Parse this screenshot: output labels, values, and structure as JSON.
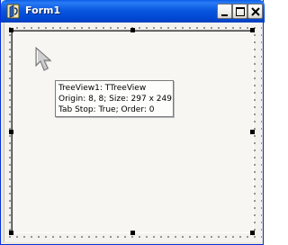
{
  "window": {
    "title": "Form1",
    "icon": "delphi-form-icon",
    "caption_buttons": [
      "minimize-icon",
      "maximize-icon",
      "close-icon"
    ]
  },
  "designer": {
    "selected_component": "TreeView1",
    "tooltip": {
      "line1": "TreeView1: TTreeView",
      "line2": "Origin: 8, 8; Size: 297 x 249",
      "line3": "Tab Stop: True; Order: 0"
    }
  },
  "colors": {
    "titlebar": "#0a58e0",
    "form_background": "#f3f2ee",
    "handle": "#000000"
  }
}
